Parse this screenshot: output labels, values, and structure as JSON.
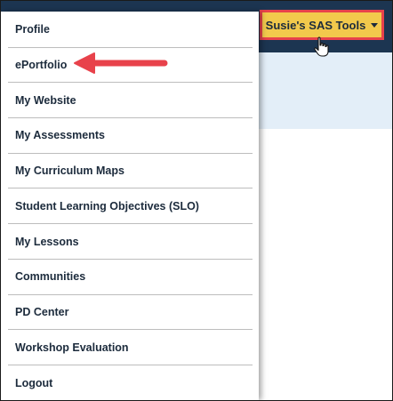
{
  "header": {
    "tools_button_label": "Susie's SAS Tools"
  },
  "menu": {
    "items": [
      {
        "label": "Profile"
      },
      {
        "label": "ePortfolio"
      },
      {
        "label": "My Website"
      },
      {
        "label": "My Assessments"
      },
      {
        "label": "My Curriculum Maps"
      },
      {
        "label": "Student Learning Objectives (SLO)"
      },
      {
        "label": "My Lessons"
      },
      {
        "label": "Communities"
      },
      {
        "label": "PD Center"
      },
      {
        "label": "Workshop Evaluation"
      },
      {
        "label": "Logout"
      }
    ]
  },
  "colors": {
    "header_bg": "#1c3551",
    "banner_bg": "#e3eef8",
    "button_bg": "#f2c94c",
    "highlight_border": "#e8424b",
    "arrow": "#e8424b",
    "text": "#1c2b3c"
  },
  "icons": {
    "dropdown": "caret-down-icon",
    "pointer": "hand-pointer-icon",
    "annotation": "red-arrow-icon"
  }
}
